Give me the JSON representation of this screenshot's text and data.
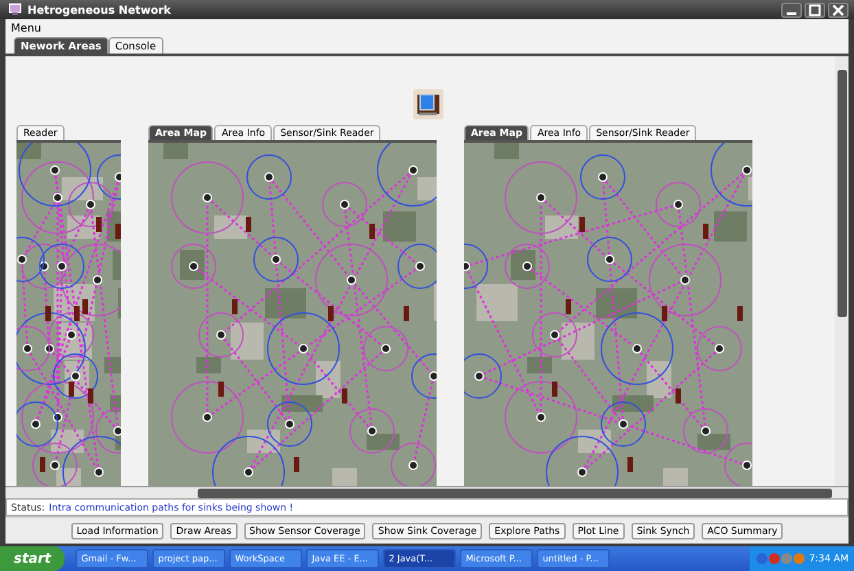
{
  "window": {
    "title": "Hetrogeneous Network"
  },
  "menu": [
    {
      "label": "Menu"
    }
  ],
  "tabs": [
    {
      "label": "Nework Areas",
      "selected": true
    },
    {
      "label": "Console",
      "selected": false
    }
  ],
  "panels": [
    {
      "tabs": [
        {
          "label": "Reader",
          "selected": false
        }
      ]
    },
    {
      "tabs": [
        {
          "label": "Area Map",
          "selected": true
        },
        {
          "label": "Area Info",
          "selected": false
        },
        {
          "label": "Sensor/Sink Reader",
          "selected": false
        }
      ]
    },
    {
      "tabs": [
        {
          "label": "Area Map",
          "selected": true
        },
        {
          "label": "Area Info",
          "selected": false
        },
        {
          "label": "Sensor/Sink Reader",
          "selected": false
        }
      ]
    }
  ],
  "status_bar": {
    "label": "Status:",
    "message": "Intra communication paths for sinks being shown !"
  },
  "buttons": [
    "Load Information",
    "Draw Areas",
    "Show Sensor Coverage",
    "Show Sink Coverage",
    "Explore Paths",
    "Plot Line",
    "Sink Synch",
    "ACO Summary"
  ],
  "taskbar": {
    "start": "start",
    "items": [
      {
        "label": "Gmail - Fw...",
        "selected": false
      },
      {
        "label": "project pap...",
        "selected": false
      },
      {
        "label": "WorkSpace",
        "selected": false
      },
      {
        "label": "Java EE - E...",
        "selected": false
      },
      {
        "label": "2 Java(T...",
        "selected": true
      },
      {
        "label": "Microsoft P...",
        "selected": false
      },
      {
        "label": "untitled - P...",
        "selected": false
      }
    ],
    "clock": "7:34 AM"
  }
}
